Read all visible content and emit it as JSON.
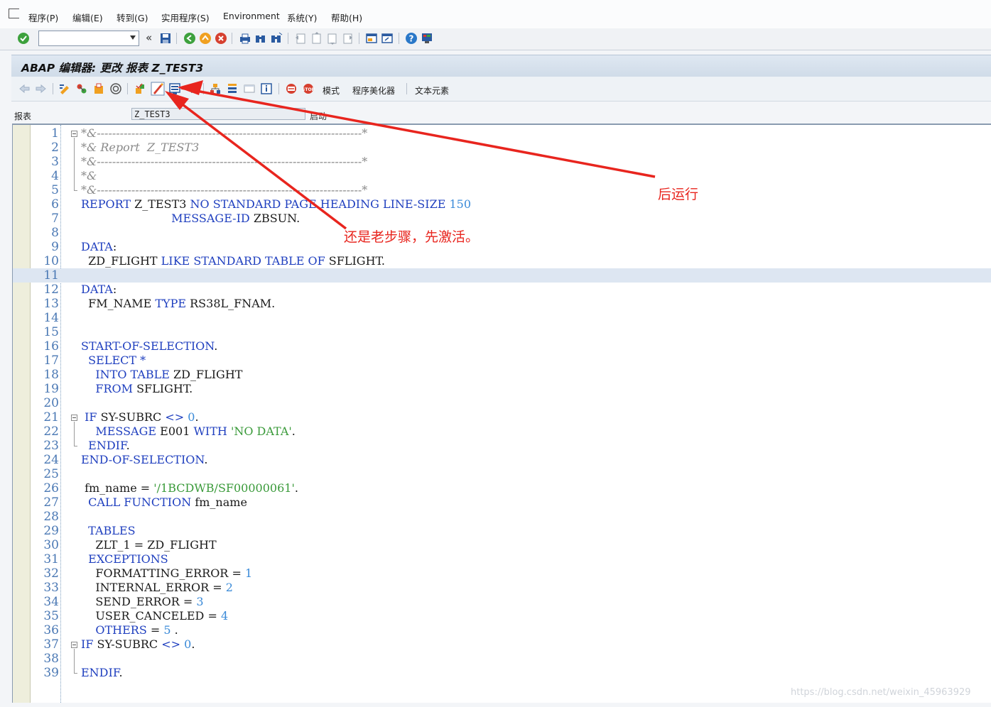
{
  "menu": {
    "items": [
      "程序(P)",
      "编辑(E)",
      "转到(G)",
      "实用程序(S)",
      "Environment",
      "系统(Y)",
      "帮助(H)"
    ]
  },
  "system_toolbar": {
    "command_field_value": "",
    "icons": [
      "enter-icon",
      "back-nav-icon",
      "save-icon",
      "back-icon",
      "exit-icon",
      "cancel-icon",
      "print-icon",
      "find-icon",
      "find-next-icon",
      "first-page-icon",
      "prev-page-icon",
      "next-page-icon",
      "last-page-icon",
      "new-session-icon",
      "shortcut-icon",
      "help-icon",
      "layout-icon"
    ]
  },
  "title": "ABAP 编辑器: 更改 报表 Z_TEST3",
  "app_toolbar": {
    "labels": {
      "mode": "模式",
      "pretty_printer": "程序美化器",
      "text_elements": "文本元素"
    }
  },
  "header": {
    "field_label": "报表",
    "field_value": "Z_TEST3",
    "status": "启动"
  },
  "colors": {
    "keyword": "#1f3fbf",
    "number": "#3a8ad8",
    "string": "#3a9a3a",
    "comment": "#8a8a8a",
    "annotation": "#e8251e",
    "highlight_row": "#dde6f2"
  },
  "editor": {
    "highlighted_line": 11,
    "lines": [
      [
        [
          "cm",
          "*&---------------------------------------------------------------------*"
        ]
      ],
      [
        [
          "cm",
          "*& Report  Z_TEST3"
        ]
      ],
      [
        [
          "cm",
          "*&---------------------------------------------------------------------*"
        ]
      ],
      [
        [
          "cm",
          "*&"
        ]
      ],
      [
        [
          "cm",
          "*&---------------------------------------------------------------------*"
        ]
      ],
      [
        [
          "kw",
          "REPORT"
        ],
        [
          "t",
          " Z_TEST3 "
        ],
        [
          "kw",
          "NO STANDARD PAGE HEADING LINE-SIZE"
        ],
        [
          "t",
          " "
        ],
        [
          "num",
          "150"
        ]
      ],
      [
        [
          "t",
          "                         "
        ],
        [
          "kw",
          "MESSAGE-ID"
        ],
        [
          "t",
          " ZBSUN."
        ]
      ],
      [
        [
          "t",
          ""
        ]
      ],
      [
        [
          "kw",
          "DATA"
        ],
        [
          "t",
          ":"
        ]
      ],
      [
        [
          "t",
          "  ZD_FLIGHT "
        ],
        [
          "kw",
          "LIKE STANDARD TABLE OF"
        ],
        [
          "t",
          " SFLIGHT."
        ]
      ],
      [
        [
          "t",
          ""
        ]
      ],
      [
        [
          "kw",
          "DATA"
        ],
        [
          "t",
          ":"
        ]
      ],
      [
        [
          "t",
          "  FM_NAME "
        ],
        [
          "kw",
          "TYPE"
        ],
        [
          "t",
          " RS38L_FNAM."
        ]
      ],
      [
        [
          "t",
          ""
        ]
      ],
      [
        [
          "t",
          ""
        ]
      ],
      [
        [
          "kw",
          "START-OF-SELECTION"
        ],
        [
          "t",
          "."
        ]
      ],
      [
        [
          "t",
          "  "
        ],
        [
          "kw",
          "SELECT"
        ],
        [
          "t",
          " "
        ],
        [
          "op",
          "*"
        ]
      ],
      [
        [
          "t",
          "    "
        ],
        [
          "kw",
          "INTO TABLE"
        ],
        [
          "t",
          " ZD_FLIGHT"
        ]
      ],
      [
        [
          "t",
          "    "
        ],
        [
          "kw",
          "FROM"
        ],
        [
          "t",
          " SFLIGHT."
        ]
      ],
      [
        [
          "t",
          ""
        ]
      ],
      [
        [
          "t",
          " "
        ],
        [
          "kw",
          "IF"
        ],
        [
          "t",
          " SY-SUBRC "
        ],
        [
          "op",
          "<>"
        ],
        [
          "t",
          " "
        ],
        [
          "num",
          "0"
        ],
        [
          "t",
          "."
        ]
      ],
      [
        [
          "t",
          "    "
        ],
        [
          "kw",
          "MESSAGE"
        ],
        [
          "t",
          " E001 "
        ],
        [
          "kw",
          "WITH"
        ],
        [
          "t",
          " "
        ],
        [
          "str",
          "'NO DATA'"
        ],
        [
          "t",
          "."
        ]
      ],
      [
        [
          "t",
          "  "
        ],
        [
          "kw",
          "ENDIF"
        ],
        [
          "t",
          "."
        ]
      ],
      [
        [
          "kw",
          "END-OF-SELECTION"
        ],
        [
          "t",
          "."
        ]
      ],
      [
        [
          "t",
          ""
        ]
      ],
      [
        [
          "t",
          " fm_name = "
        ],
        [
          "str",
          "'/1BCDWB/SF00000061'"
        ],
        [
          "t",
          "."
        ]
      ],
      [
        [
          "t",
          "  "
        ],
        [
          "kw",
          "CALL FUNCTION"
        ],
        [
          "t",
          " fm_name"
        ]
      ],
      [
        [
          "t",
          ""
        ]
      ],
      [
        [
          "t",
          "  "
        ],
        [
          "kw",
          "TABLES"
        ]
      ],
      [
        [
          "t",
          "    ZLT_1 = ZD_FLIGHT"
        ]
      ],
      [
        [
          "t",
          "  "
        ],
        [
          "kw",
          "EXCEPTIONS"
        ]
      ],
      [
        [
          "t",
          "    FORMATTING_ERROR = "
        ],
        [
          "num",
          "1"
        ]
      ],
      [
        [
          "t",
          "    INTERNAL_ERROR = "
        ],
        [
          "num",
          "2"
        ]
      ],
      [
        [
          "t",
          "    SEND_ERROR = "
        ],
        [
          "num",
          "3"
        ]
      ],
      [
        [
          "t",
          "    USER_CANCELED = "
        ],
        [
          "num",
          "4"
        ]
      ],
      [
        [
          "t",
          "    "
        ],
        [
          "kw",
          "OTHERS"
        ],
        [
          "t",
          " = "
        ],
        [
          "num",
          "5"
        ],
        [
          "t",
          " ."
        ]
      ],
      [
        [
          "kw",
          "IF"
        ],
        [
          "t",
          " SY-SUBRC "
        ],
        [
          "op",
          "<>"
        ],
        [
          "t",
          " "
        ],
        [
          "num",
          "0"
        ],
        [
          "t",
          "."
        ]
      ],
      [
        [
          "t",
          ""
        ]
      ],
      [
        [
          "kw",
          "ENDIF"
        ],
        [
          "t",
          "."
        ]
      ]
    ]
  },
  "annotations": {
    "run_after": "后运行",
    "activate_first": "还是老步骤，先激活。"
  },
  "watermark": "https://blog.csdn.net/weixin_45963929"
}
